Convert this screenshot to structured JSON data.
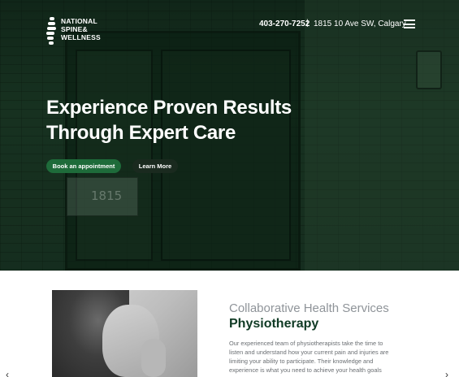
{
  "header": {
    "logo_text": "NATIONAL\nSPINE&\nWELLNESS",
    "phone": "403-270-7252",
    "separator": "|",
    "address": "1815 10 Ave SW, Calgary",
    "menu_icon": "hamburger-icon"
  },
  "hero": {
    "title": "Experience Proven Results Through Expert Care",
    "book_label": "Book an appointment",
    "learn_label": "Learn More",
    "sign_number": "1815"
  },
  "services": {
    "subtitle": "Collaborative Health Services",
    "title": "Physiotherapy",
    "body": "Our experienced team of physiotherapists take the time to listen and understand how your current pain and injuries are limiting your ability to participate. Their knowledge and experience is what you need to achieve your health goals"
  },
  "carousel": {
    "prev_icon": "chevron-left-icon",
    "next_icon": "chevron-right-icon",
    "prev_glyph": "‹",
    "next_glyph": "›"
  },
  "colors": {
    "accent": "#1e6b3a",
    "title_green": "#0f3a24"
  }
}
